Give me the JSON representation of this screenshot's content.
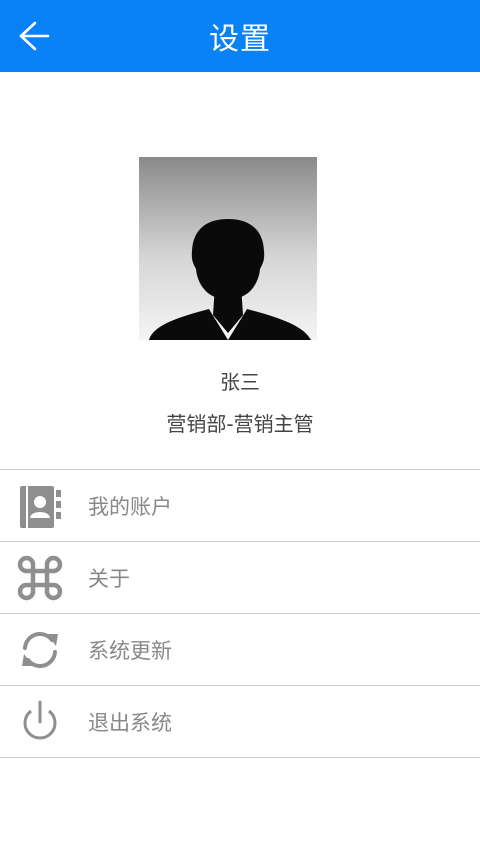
{
  "header": {
    "title": "设置",
    "background_color": "#0a82f7",
    "back_icon": "arrow-left-icon"
  },
  "profile": {
    "name": "张三",
    "department": "营销部-营销主管",
    "avatar_icon": "person-silhouette"
  },
  "menu": {
    "items": [
      {
        "label": "我的账户",
        "icon": "contact-book-icon"
      },
      {
        "label": "关于",
        "icon": "command-icon"
      },
      {
        "label": "系统更新",
        "icon": "refresh-icon"
      },
      {
        "label": "退出系统",
        "icon": "power-icon"
      }
    ],
    "icon_color": "#8f8f8f",
    "label_color": "#888888"
  }
}
